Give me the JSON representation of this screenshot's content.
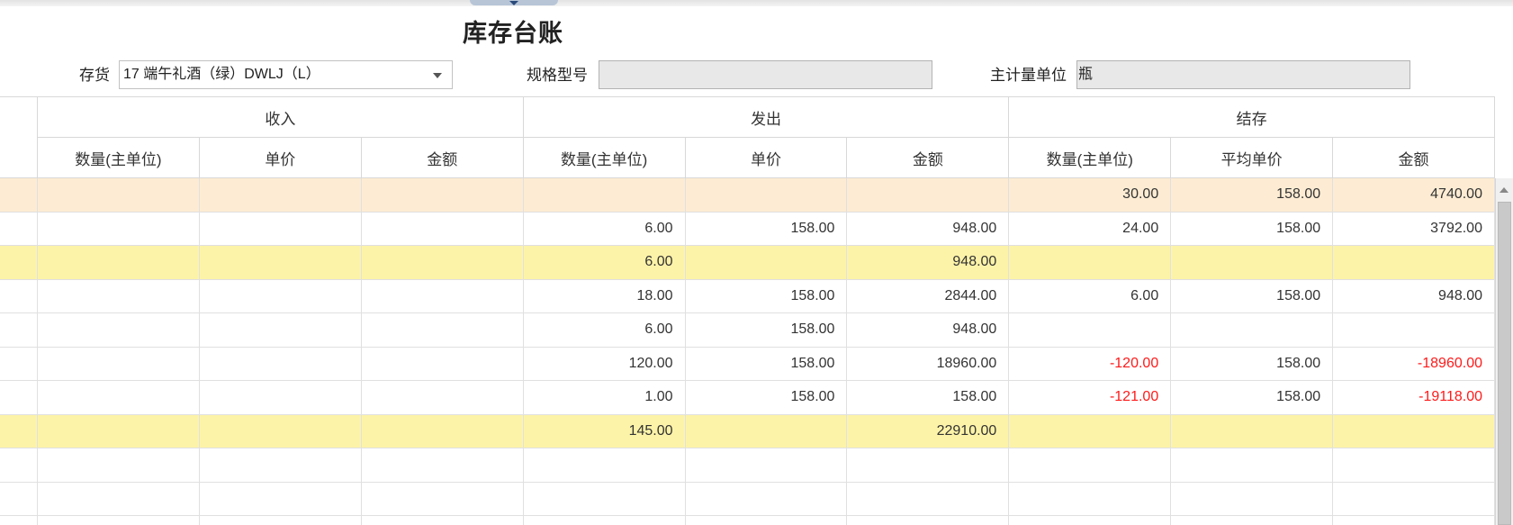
{
  "title": "库存台账",
  "filters": {
    "inventory_label": "存货",
    "inventory_value": "17 端午礼酒（绿）DWLJ（L）",
    "spec_label": "规格型号",
    "spec_value": "",
    "unit_label": "主计量单位",
    "unit_value": "瓶"
  },
  "table": {
    "groups": [
      "收入",
      "发出",
      "结存"
    ],
    "columns": [
      "数量(主单位)",
      "单价",
      "金额",
      "数量(主单位)",
      "单价",
      "金额",
      "数量(主单位)",
      "平均单价",
      "金额"
    ],
    "rows": [
      {
        "bg": "#fdecd3",
        "cells": [
          "",
          "",
          "",
          "",
          "",
          "",
          "30.00",
          "158.00",
          "4740.00"
        ]
      },
      {
        "bg": "#ffffff",
        "cells": [
          "",
          "",
          "",
          "6.00",
          "158.00",
          "948.00",
          "24.00",
          "158.00",
          "3792.00"
        ]
      },
      {
        "bg": "#fdf3a8",
        "cells": [
          "",
          "",
          "",
          "6.00",
          "",
          "948.00",
          "",
          "",
          ""
        ]
      },
      {
        "bg": "#ffffff",
        "cells": [
          "",
          "",
          "",
          "18.00",
          "158.00",
          "2844.00",
          "6.00",
          "158.00",
          "948.00"
        ]
      },
      {
        "bg": "#ffffff",
        "cells": [
          "",
          "",
          "",
          "6.00",
          "158.00",
          "948.00",
          "",
          "",
          ""
        ]
      },
      {
        "bg": "#ffffff",
        "cells": [
          "",
          "",
          "",
          "120.00",
          "158.00",
          "18960.00",
          "-120.00",
          "158.00",
          "-18960.00"
        ]
      },
      {
        "bg": "#ffffff",
        "cells": [
          "",
          "",
          "",
          "1.00",
          "158.00",
          "158.00",
          "-121.00",
          "158.00",
          "-19118.00"
        ]
      },
      {
        "bg": "#fdf3a8",
        "cells": [
          "",
          "",
          "",
          "145.00",
          "",
          "22910.00",
          "",
          "",
          ""
        ]
      },
      {
        "bg": "#ffffff",
        "cells": [
          "",
          "",
          "",
          "",
          "",
          "",
          "",
          "",
          ""
        ]
      },
      {
        "bg": "#ffffff",
        "cells": [
          "",
          "",
          "",
          "",
          "",
          "",
          "",
          "",
          ""
        ]
      },
      {
        "bg": "#ffffff",
        "cells": [
          "",
          "",
          "",
          "",
          "",
          "",
          "",
          "",
          ""
        ]
      }
    ]
  },
  "icons": {
    "handle": "chevron-down-icon",
    "dropdown": "chevron-down-icon",
    "scroll_up": "triangle-up-icon"
  },
  "colors": {
    "negative": "#ff1a1a",
    "opening_row": "#fdecd3",
    "subtotal_row": "#fdf3a8",
    "handle": "#b7c5d7"
  }
}
